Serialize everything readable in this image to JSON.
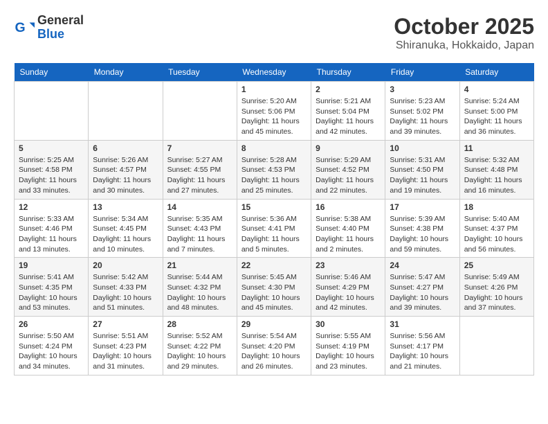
{
  "logo": {
    "general": "General",
    "blue": "Blue"
  },
  "header": {
    "month": "October 2025",
    "location": "Shiranuka, Hokkaido, Japan"
  },
  "weekdays": [
    "Sunday",
    "Monday",
    "Tuesday",
    "Wednesday",
    "Thursday",
    "Friday",
    "Saturday"
  ],
  "weeks": [
    [
      null,
      null,
      null,
      {
        "day": "1",
        "sunrise": "Sunrise: 5:20 AM",
        "sunset": "Sunset: 5:06 PM",
        "daylight": "Daylight: 11 hours and 45 minutes."
      },
      {
        "day": "2",
        "sunrise": "Sunrise: 5:21 AM",
        "sunset": "Sunset: 5:04 PM",
        "daylight": "Daylight: 11 hours and 42 minutes."
      },
      {
        "day": "3",
        "sunrise": "Sunrise: 5:23 AM",
        "sunset": "Sunset: 5:02 PM",
        "daylight": "Daylight: 11 hours and 39 minutes."
      },
      {
        "day": "4",
        "sunrise": "Sunrise: 5:24 AM",
        "sunset": "Sunset: 5:00 PM",
        "daylight": "Daylight: 11 hours and 36 minutes."
      }
    ],
    [
      {
        "day": "5",
        "sunrise": "Sunrise: 5:25 AM",
        "sunset": "Sunset: 4:58 PM",
        "daylight": "Daylight: 11 hours and 33 minutes."
      },
      {
        "day": "6",
        "sunrise": "Sunrise: 5:26 AM",
        "sunset": "Sunset: 4:57 PM",
        "daylight": "Daylight: 11 hours and 30 minutes."
      },
      {
        "day": "7",
        "sunrise": "Sunrise: 5:27 AM",
        "sunset": "Sunset: 4:55 PM",
        "daylight": "Daylight: 11 hours and 27 minutes."
      },
      {
        "day": "8",
        "sunrise": "Sunrise: 5:28 AM",
        "sunset": "Sunset: 4:53 PM",
        "daylight": "Daylight: 11 hours and 25 minutes."
      },
      {
        "day": "9",
        "sunrise": "Sunrise: 5:29 AM",
        "sunset": "Sunset: 4:52 PM",
        "daylight": "Daylight: 11 hours and 22 minutes."
      },
      {
        "day": "10",
        "sunrise": "Sunrise: 5:31 AM",
        "sunset": "Sunset: 4:50 PM",
        "daylight": "Daylight: 11 hours and 19 minutes."
      },
      {
        "day": "11",
        "sunrise": "Sunrise: 5:32 AM",
        "sunset": "Sunset: 4:48 PM",
        "daylight": "Daylight: 11 hours and 16 minutes."
      }
    ],
    [
      {
        "day": "12",
        "sunrise": "Sunrise: 5:33 AM",
        "sunset": "Sunset: 4:46 PM",
        "daylight": "Daylight: 11 hours and 13 minutes."
      },
      {
        "day": "13",
        "sunrise": "Sunrise: 5:34 AM",
        "sunset": "Sunset: 4:45 PM",
        "daylight": "Daylight: 11 hours and 10 minutes."
      },
      {
        "day": "14",
        "sunrise": "Sunrise: 5:35 AM",
        "sunset": "Sunset: 4:43 PM",
        "daylight": "Daylight: 11 hours and 7 minutes."
      },
      {
        "day": "15",
        "sunrise": "Sunrise: 5:36 AM",
        "sunset": "Sunset: 4:41 PM",
        "daylight": "Daylight: 11 hours and 5 minutes."
      },
      {
        "day": "16",
        "sunrise": "Sunrise: 5:38 AM",
        "sunset": "Sunset: 4:40 PM",
        "daylight": "Daylight: 11 hours and 2 minutes."
      },
      {
        "day": "17",
        "sunrise": "Sunrise: 5:39 AM",
        "sunset": "Sunset: 4:38 PM",
        "daylight": "Daylight: 10 hours and 59 minutes."
      },
      {
        "day": "18",
        "sunrise": "Sunrise: 5:40 AM",
        "sunset": "Sunset: 4:37 PM",
        "daylight": "Daylight: 10 hours and 56 minutes."
      }
    ],
    [
      {
        "day": "19",
        "sunrise": "Sunrise: 5:41 AM",
        "sunset": "Sunset: 4:35 PM",
        "daylight": "Daylight: 10 hours and 53 minutes."
      },
      {
        "day": "20",
        "sunrise": "Sunrise: 5:42 AM",
        "sunset": "Sunset: 4:33 PM",
        "daylight": "Daylight: 10 hours and 51 minutes."
      },
      {
        "day": "21",
        "sunrise": "Sunrise: 5:44 AM",
        "sunset": "Sunset: 4:32 PM",
        "daylight": "Daylight: 10 hours and 48 minutes."
      },
      {
        "day": "22",
        "sunrise": "Sunrise: 5:45 AM",
        "sunset": "Sunset: 4:30 PM",
        "daylight": "Daylight: 10 hours and 45 minutes."
      },
      {
        "day": "23",
        "sunrise": "Sunrise: 5:46 AM",
        "sunset": "Sunset: 4:29 PM",
        "daylight": "Daylight: 10 hours and 42 minutes."
      },
      {
        "day": "24",
        "sunrise": "Sunrise: 5:47 AM",
        "sunset": "Sunset: 4:27 PM",
        "daylight": "Daylight: 10 hours and 39 minutes."
      },
      {
        "day": "25",
        "sunrise": "Sunrise: 5:49 AM",
        "sunset": "Sunset: 4:26 PM",
        "daylight": "Daylight: 10 hours and 37 minutes."
      }
    ],
    [
      {
        "day": "26",
        "sunrise": "Sunrise: 5:50 AM",
        "sunset": "Sunset: 4:24 PM",
        "daylight": "Daylight: 10 hours and 34 minutes."
      },
      {
        "day": "27",
        "sunrise": "Sunrise: 5:51 AM",
        "sunset": "Sunset: 4:23 PM",
        "daylight": "Daylight: 10 hours and 31 minutes."
      },
      {
        "day": "28",
        "sunrise": "Sunrise: 5:52 AM",
        "sunset": "Sunset: 4:22 PM",
        "daylight": "Daylight: 10 hours and 29 minutes."
      },
      {
        "day": "29",
        "sunrise": "Sunrise: 5:54 AM",
        "sunset": "Sunset: 4:20 PM",
        "daylight": "Daylight: 10 hours and 26 minutes."
      },
      {
        "day": "30",
        "sunrise": "Sunrise: 5:55 AM",
        "sunset": "Sunset: 4:19 PM",
        "daylight": "Daylight: 10 hours and 23 minutes."
      },
      {
        "day": "31",
        "sunrise": "Sunrise: 5:56 AM",
        "sunset": "Sunset: 4:17 PM",
        "daylight": "Daylight: 10 hours and 21 minutes."
      },
      null
    ]
  ]
}
